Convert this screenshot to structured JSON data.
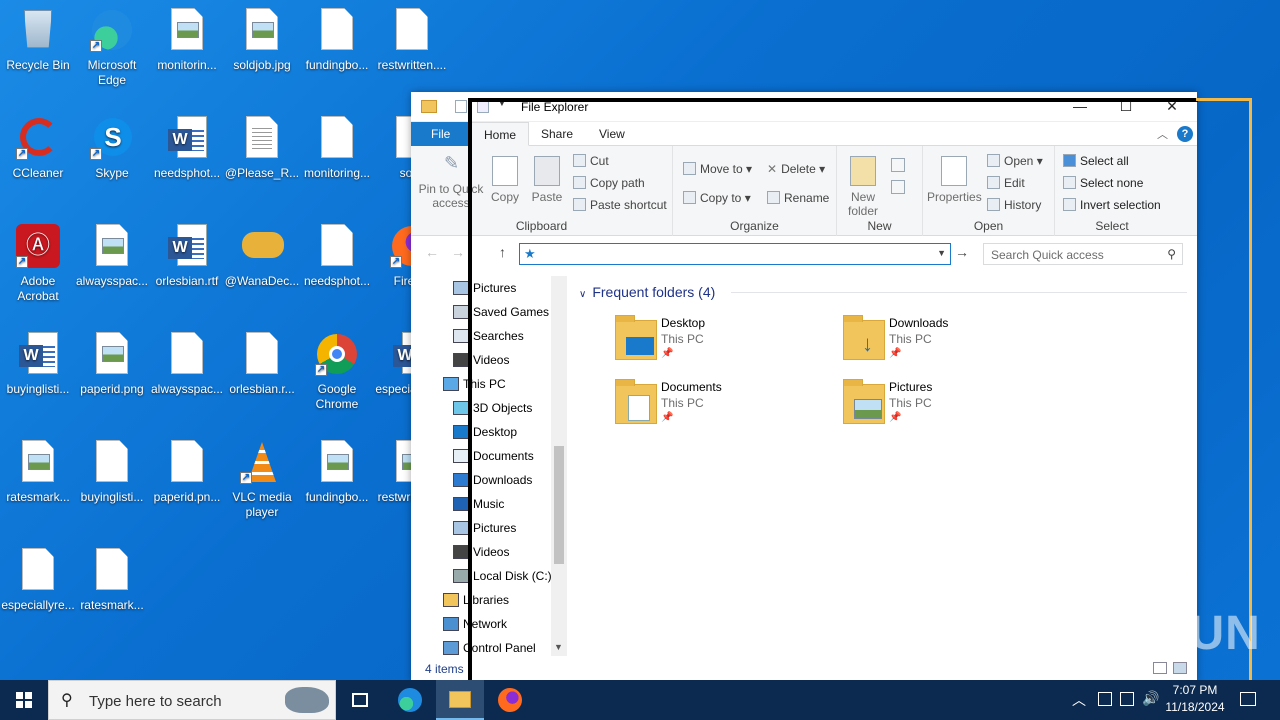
{
  "desktop": {
    "icons": [
      {
        "label": "Recycle Bin",
        "icon": "recycle-bin-icon"
      },
      {
        "label": "Microsoft Edge",
        "icon": "edge-icon"
      },
      {
        "label": "monitorin...",
        "icon": "image-file-icon"
      },
      {
        "label": "soldjob.jpg",
        "icon": "image-file-icon"
      },
      {
        "label": "fundingbo...",
        "icon": "blank-file-icon"
      },
      {
        "label": "restwritten....",
        "icon": "blank-file-icon"
      },
      {
        "label": "CCleaner",
        "icon": "ccleaner-icon"
      },
      {
        "label": "Skype",
        "icon": "skype-icon"
      },
      {
        "label": "needsphot...",
        "icon": "word-file-icon"
      },
      {
        "label": "@Please_R...",
        "icon": "text-file-icon"
      },
      {
        "label": "monitoring...",
        "icon": "blank-file-icon"
      },
      {
        "label": "soldj",
        "icon": "blank-file-icon"
      },
      {
        "label": "Adobe Acrobat",
        "icon": "acrobat-icon"
      },
      {
        "label": "alwaysspac...",
        "icon": "image-file-icon"
      },
      {
        "label": "orlesbian.rtf",
        "icon": "word-file-icon"
      },
      {
        "label": "@WanaDec...",
        "icon": "handshake-icon"
      },
      {
        "label": "needsphot...",
        "icon": "blank-file-icon"
      },
      {
        "label": "Firefox",
        "icon": "firefox-icon"
      },
      {
        "label": "buyinglisti...",
        "icon": "word-file-icon"
      },
      {
        "label": "paperid.png",
        "icon": "image-file-icon"
      },
      {
        "label": "alwaysspac...",
        "icon": "blank-file-icon"
      },
      {
        "label": "orlesbian.r...",
        "icon": "blank-file-icon"
      },
      {
        "label": "Google Chrome",
        "icon": "chrome-icon"
      },
      {
        "label": "especiallyre...",
        "icon": "word-file-icon"
      },
      {
        "label": "ratesmark...",
        "icon": "image-file-icon"
      },
      {
        "label": "buyinglisti...",
        "icon": "blank-file-icon"
      },
      {
        "label": "paperid.pn...",
        "icon": "blank-file-icon"
      },
      {
        "label": "VLC media player",
        "icon": "vlc-icon"
      },
      {
        "label": "fundingbo...",
        "icon": "image-file-icon"
      },
      {
        "label": "restwritten....",
        "icon": "image-file-icon"
      },
      {
        "label": "especiallyre...",
        "icon": "blank-file-icon"
      },
      {
        "label": "ratesmark...",
        "icon": "blank-file-icon"
      }
    ]
  },
  "explorer": {
    "title": "File Explorer",
    "tabs": [
      "File",
      "Home",
      "Share",
      "View"
    ],
    "ribbon": {
      "pin_label": "Pin to Quick access",
      "copy": "Copy",
      "paste": "Paste",
      "cut": "Cut",
      "copy_path": "Copy path",
      "paste_shortcut": "Paste shortcut",
      "clipboard": "Clipboard",
      "move_to": "Move to",
      "copy_to": "Copy to",
      "delete": "Delete",
      "rename": "Rename",
      "organize": "Organize",
      "new_folder": "New folder",
      "new": "New",
      "properties": "Properties",
      "open": "Open",
      "edit": "Edit",
      "history": "History",
      "open_group": "Open",
      "select_all": "Select all",
      "select_none": "Select none",
      "invert_selection": "Invert selection",
      "select_group": "Select"
    },
    "search_placeholder": "Search Quick access",
    "nav": [
      "Pictures",
      "Saved Games",
      "Searches",
      "Videos",
      "This PC",
      "3D Objects",
      "Desktop",
      "Documents",
      "Downloads",
      "Music",
      "Pictures",
      "Videos",
      "Local Disk (C:)",
      "Libraries",
      "Network",
      "Control Panel"
    ],
    "section_title": "Frequent folders (4)",
    "folders": [
      {
        "name": "Desktop",
        "location": "This PC"
      },
      {
        "name": "Downloads",
        "location": "This PC"
      },
      {
        "name": "Documents",
        "location": "This PC"
      },
      {
        "name": "Pictures",
        "location": "This PC"
      }
    ],
    "status": "4 items"
  },
  "taskbar": {
    "search_placeholder": "Type here to search",
    "time": "7:07 PM",
    "date": "11/18/2024"
  },
  "watermark": "ANY RUN",
  "colors": {
    "desktop": "#0a78d7",
    "taskbar": "#0c2a4f",
    "accent": "#1979ca",
    "highlight": "#f1b84a"
  }
}
